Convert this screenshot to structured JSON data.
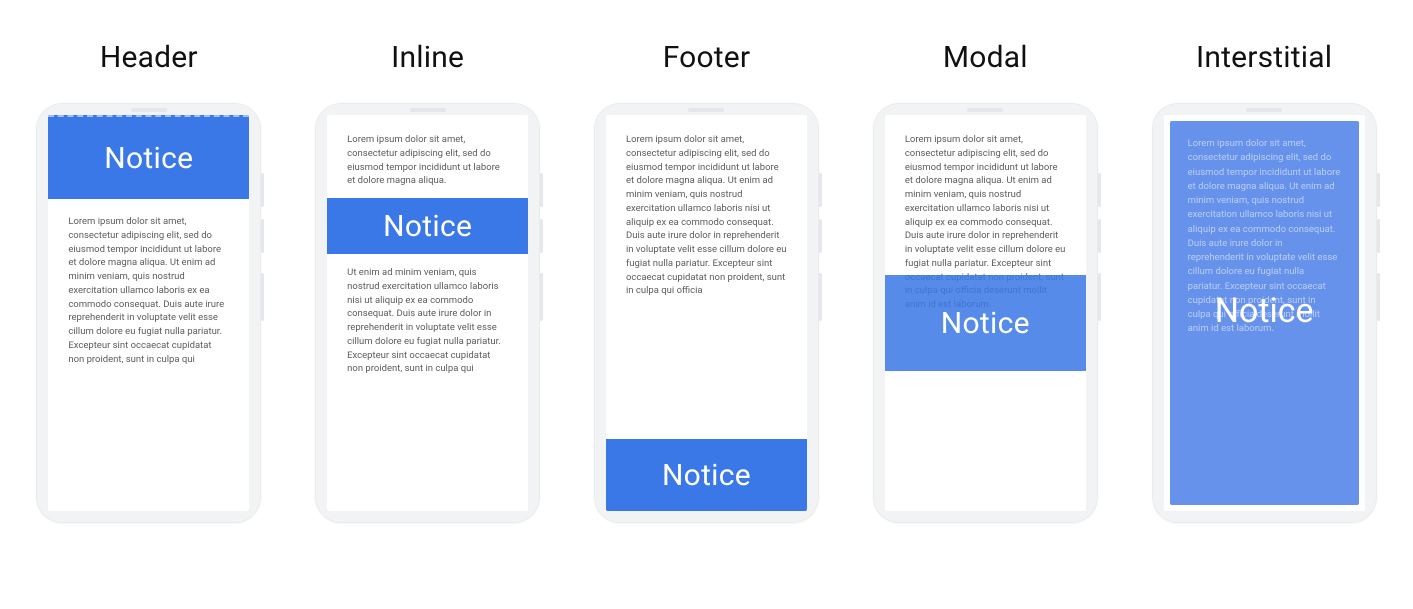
{
  "notice_label": "Notice",
  "variants": [
    {
      "id": "header",
      "title": "Header"
    },
    {
      "id": "inline",
      "title": "Inline"
    },
    {
      "id": "footer",
      "title": "Footer"
    },
    {
      "id": "modal",
      "title": "Modal"
    },
    {
      "id": "interstitial",
      "title": "Interstitial"
    }
  ],
  "lorem": {
    "p_short": "Lorem ipsum dolor sit amet, consectetur adipiscing elit, sed do eiusmod tempor incididunt ut labore et dolore magna aliqua.",
    "p_header": "Lorem ipsum dolor sit amet, consectetur adipiscing elit, sed do eiusmod tempor incididunt ut labore et dolore magna aliqua. Ut enim ad minim veniam, quis nostrud exercitation ullamco laboris ex ea commodo consequat. Duis aute irure reprehenderit in voluptate velit esse cillum dolore eu fugiat nulla pariatur. Excepteur sint occaecat cupidatat non proident, sunt in culpa qui",
    "p_inline2": "Ut enim ad minim veniam, quis nostrud exercitation ullamco laboris nisi ut aliquip ex ea commodo consequat. Duis aute irure dolor in reprehenderit in voluptate velit esse cillum dolore eu fugiat nulla pariatur. Excepteur sint occaecat cupidatat non proident, sunt in culpa qui",
    "p_footer": "Lorem ipsum dolor sit amet, consectetur adipiscing elit, sed do eiusmod tempor incididunt ut labore et dolore magna aliqua. Ut enim ad minim veniam, quis nostrud exercitation ullamco laboris nisi ut aliquip ex ea commodo consequat. Duis aute irure dolor in reprehenderit in voluptate velit esse cillum dolore eu fugiat nulla pariatur. Excepteur sint occaecat cupidatat non proident, sunt in culpa qui officia",
    "p_modal": "Lorem ipsum dolor sit amet, consectetur adipiscing elit, sed do eiusmod tempor incididunt ut labore et dolore magna aliqua. Ut enim ad minim veniam, quis nostrud exercitation ullamco laboris nisi ut aliquip ex ea commodo consequat. Duis aute irure dolor in reprehenderit in voluptate velit esse cillum dolore eu fugiat nulla pariatur. Excepteur sint occaecat cupidatat non proident, sunt in culpa qui officia deserunt mollit anim id est laborum.",
    "p_interstitial": "Lorem ipsum dolor sit amet, consectetur adipiscing elit, sed do eiusmod tempor incididunt ut labore et dolore magna aliqua. Ut enim ad minim veniam, quis nostrud exercitation ullamco laboris nisi ut aliquip ex ea commodo consequat. Duis aute irure dolor in reprehenderit in voluptate velit esse cillum dolore eu fugiat nulla pariatur. Excepteur sint occaecat cupidatat non proident, sunt in culpa qui officia deserunt mollit anim id est laborum."
  },
  "colors": {
    "notice_bg": "#3b78e7",
    "notice_bg_translucent": "rgba(59,120,231,0.86)",
    "scrim_bg": "rgba(86,134,233,0.90)",
    "phone_bg": "#f2f3f5",
    "text_muted": "#5c5c5c"
  }
}
